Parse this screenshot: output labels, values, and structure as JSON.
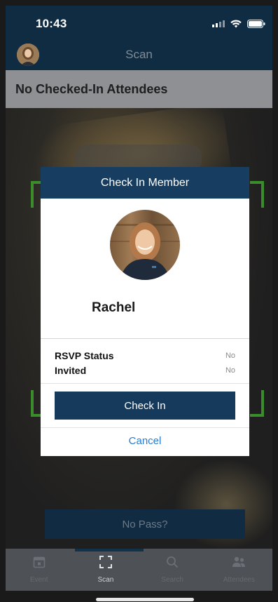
{
  "status_bar": {
    "time": "10:43"
  },
  "nav": {
    "title": "Scan"
  },
  "banner": {
    "text": "No Checked-In Attendees"
  },
  "modal": {
    "title": "Check In Member",
    "member_name": "Rachel",
    "rows": [
      {
        "label": "RSVP Status",
        "value": "No"
      },
      {
        "label": "Invited",
        "value": "No"
      }
    ],
    "primary_button": "Check In",
    "cancel_label": "Cancel"
  },
  "no_pass_button": "No Pass?",
  "tabs": [
    {
      "label": "Event",
      "icon": "calendar-icon",
      "active": false
    },
    {
      "label": "Scan",
      "icon": "scan-icon",
      "active": true
    },
    {
      "label": "Search",
      "icon": "search-icon",
      "active": false
    },
    {
      "label": "Attendees",
      "icon": "people-icon",
      "active": false
    }
  ],
  "colors": {
    "nav_bg": "#0f2c43",
    "modal_header": "#173d60",
    "primary_button": "#163a5b",
    "link": "#2b7bd0",
    "scan_bracket": "#3b8d2c"
  }
}
